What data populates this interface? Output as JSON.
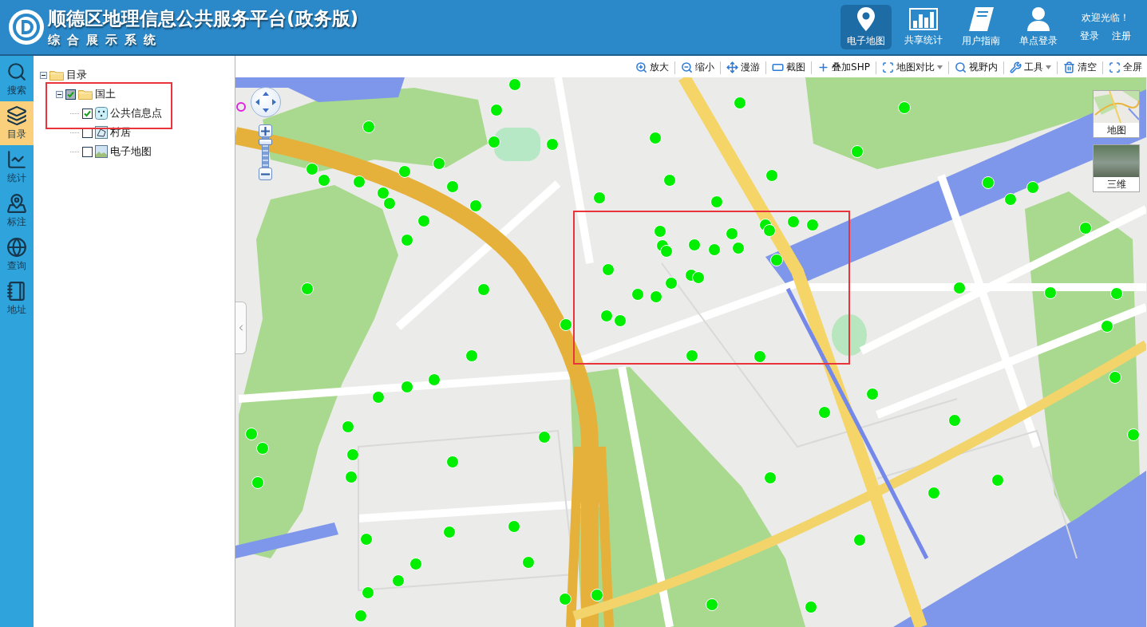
{
  "header": {
    "title": "顺德区地理信息公共服务平台(政务版)",
    "subtitle": "综合展示系统",
    "nav": [
      {
        "label": "电子地图",
        "selected": true
      },
      {
        "label": "共享统计",
        "selected": false
      },
      {
        "label": "用户指南",
        "selected": false
      },
      {
        "label": "单点登录",
        "selected": false
      }
    ],
    "welcome": "欢迎光临！",
    "links": [
      "登录",
      "注册"
    ]
  },
  "sidebar": {
    "items": [
      {
        "label": "搜索",
        "selected": false
      },
      {
        "label": "目录",
        "selected": true
      },
      {
        "label": "统计",
        "selected": false
      },
      {
        "label": "标注",
        "selected": false
      },
      {
        "label": "查询",
        "selected": false
      },
      {
        "label": "地址",
        "selected": false
      }
    ]
  },
  "catalog": {
    "tree": [
      {
        "label": "目录",
        "expanded": true,
        "children": [
          {
            "label": "国土",
            "expanded": true,
            "checked": true,
            "partial": true,
            "children": [
              {
                "label": "公共信息点",
                "checked": true
              },
              {
                "label": "村居",
                "checked": false
              },
              {
                "label": "电子地图",
                "checked": false
              }
            ]
          }
        ]
      }
    ]
  },
  "toolbar": {
    "items": [
      {
        "label": "放大",
        "dropdown": false
      },
      {
        "label": "缩小",
        "dropdown": false
      },
      {
        "label": "漫游",
        "dropdown": false
      },
      {
        "label": "截图",
        "dropdown": false
      },
      {
        "label": "叠加SHP",
        "dropdown": false
      },
      {
        "label": "地图对比",
        "dropdown": true
      },
      {
        "label": "视野内",
        "dropdown": false
      },
      {
        "label": "工具",
        "dropdown": true
      },
      {
        "label": "清空",
        "dropdown": false
      },
      {
        "label": "全屏",
        "dropdown": false
      }
    ]
  },
  "map_controls": {
    "zoom": {
      "level": 0.95
    }
  },
  "basemaps": [
    {
      "label": "地图",
      "kind": "map"
    },
    {
      "label": "三维",
      "kind": "photo"
    }
  ]
}
